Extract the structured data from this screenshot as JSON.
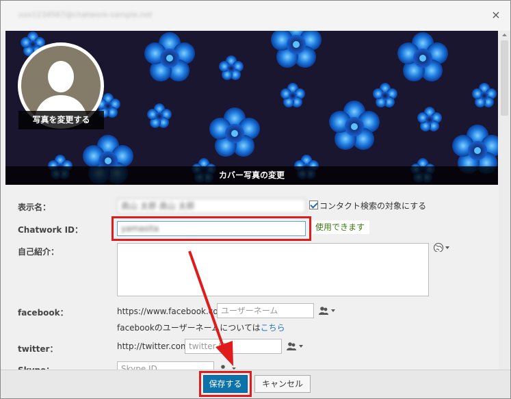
{
  "dialog": {
    "title": "xxx1234567@chatwork-sample.net",
    "close_glyph": "×"
  },
  "cover": {
    "photo_change_label": "写真を変更する",
    "cover_change_label": "カバー写真の変更"
  },
  "form": {
    "display_name": {
      "label": "表示名：",
      "value": "高山 太郎 高山 太郎",
      "contact_search_label": "コンタクト検索の対象にする",
      "contact_search_checked": true
    },
    "chatwork_id": {
      "label": "Chatwork ID：",
      "value": "yamasita",
      "status": "使用できます"
    },
    "bio": {
      "label": "自己紹介："
    },
    "facebook": {
      "label": "facebook：",
      "prefix": "https://www.facebook.com/",
      "placeholder": "ユーザーネーム",
      "help_text": "facebookのユーザーネームについては",
      "help_link": "こちら"
    },
    "twitter": {
      "label": "twitter：",
      "prefix": "http://twitter.com/",
      "placeholder": "twitter ID"
    },
    "skype": {
      "label": "Skype：",
      "placeholder": "Skype ID"
    }
  },
  "footer": {
    "save_label": "保存する",
    "cancel_label": "キャンセル"
  },
  "colors": {
    "primary": "#0e72aa",
    "highlight": "#e01b1b",
    "link": "#1e73be",
    "status_ok": "#3c7a12"
  }
}
